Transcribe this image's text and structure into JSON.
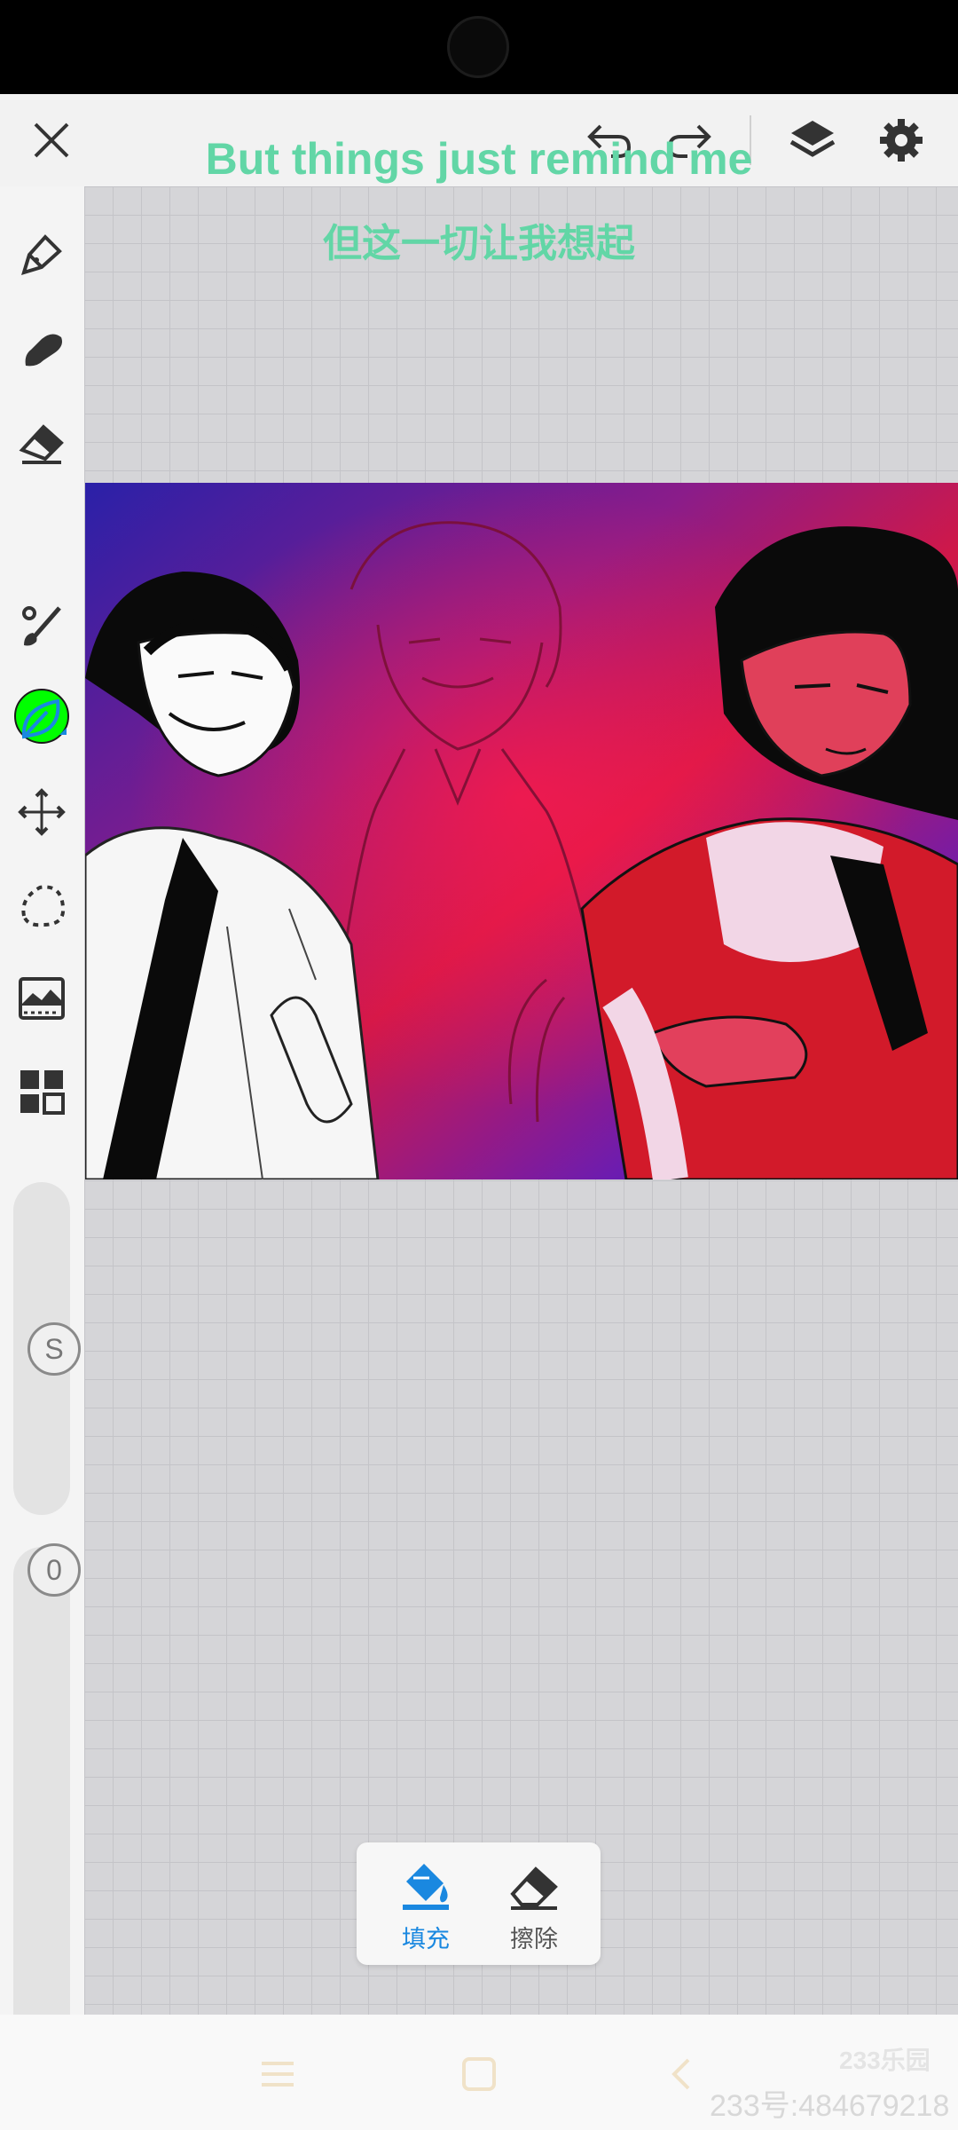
{
  "toolbar": {
    "close_icon": "close-icon",
    "undo_icon": "undo-icon",
    "redo_icon": "redo-icon",
    "layers_icon": "layers-icon",
    "settings_icon": "gear-icon"
  },
  "overlay_lyrics": {
    "english": "But things just remind me",
    "chinese": "但这一切让我想起"
  },
  "sidebar": {
    "tools": [
      "pen-tool",
      "brush-tool",
      "eraser-tool",
      "color-picker",
      "smudge-tool",
      "fill-tool",
      "move-tool",
      "lasso-tool",
      "filter-tool",
      "gallery-tool"
    ],
    "current_color": "#00ff00",
    "size_slider_label": "S",
    "opacity_slider_label": "0"
  },
  "fill_popup": {
    "fill_label": "填充",
    "erase_label": "擦除",
    "active_color": "#1a88e0"
  },
  "watermark": {
    "logo": "233乐园",
    "id": "233号:484679218"
  }
}
